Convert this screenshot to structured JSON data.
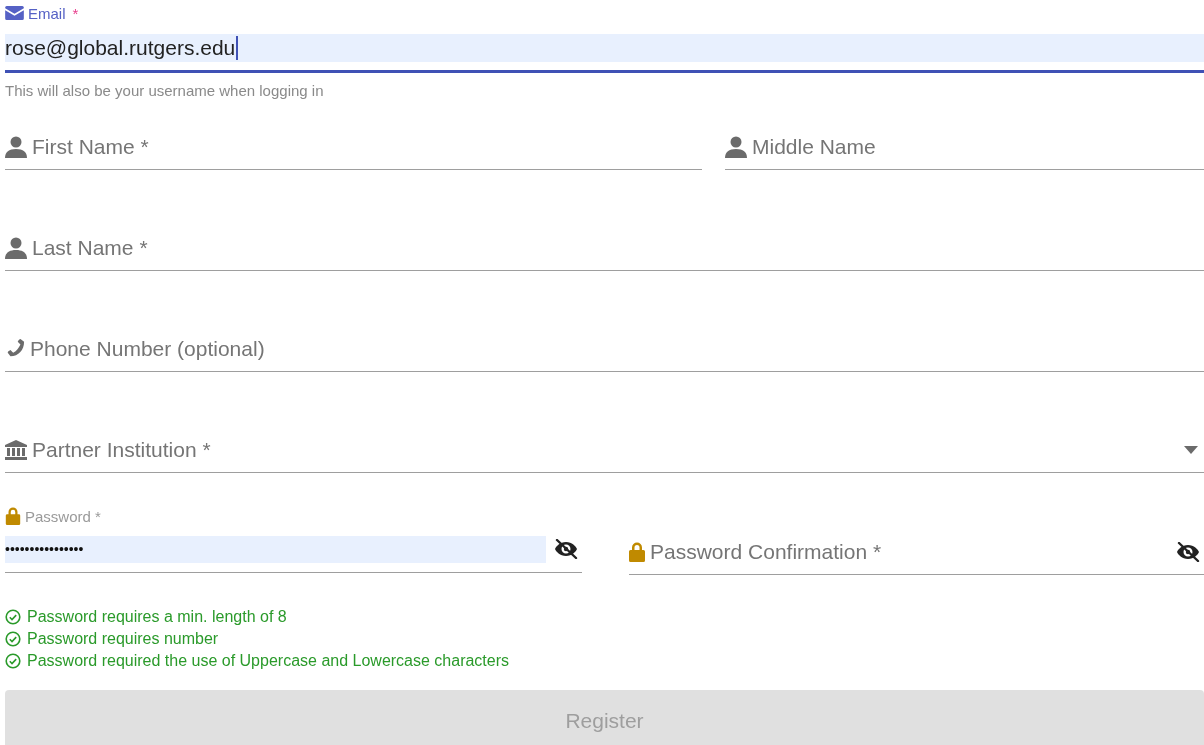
{
  "email": {
    "label": "Email",
    "required_mark": "*",
    "value": "rose@global.rutgers.edu",
    "focused": true,
    "hint": "This will also be your username when logging in"
  },
  "rows": [
    [
      {
        "kind": "name",
        "placeholder": "First Name *"
      },
      {
        "kind": "name",
        "placeholder": "Middle Name"
      }
    ],
    [
      {
        "kind": "name",
        "placeholder": "Last Name *"
      }
    ],
    [
      {
        "kind": "phone",
        "placeholder": "Phone Number (optional)"
      }
    ],
    [
      {
        "kind": "institution",
        "placeholder": "Partner Institution *"
      }
    ],
    [
      {
        "kind": "password",
        "label": "Password *",
        "value": "••••••••••••••••"
      },
      {
        "kind": "password",
        "placeholder": "Password Confirmation *"
      }
    ]
  ],
  "rules": [
    {
      "text": "Password requires a min. length of 8",
      "met": true
    },
    {
      "text": "Password requires number",
      "met": true
    },
    {
      "text": "Password required the use of Uppercase and Lowercase characters",
      "met": true
    }
  ],
  "button": {
    "label": "Register",
    "disabled": true
  }
}
